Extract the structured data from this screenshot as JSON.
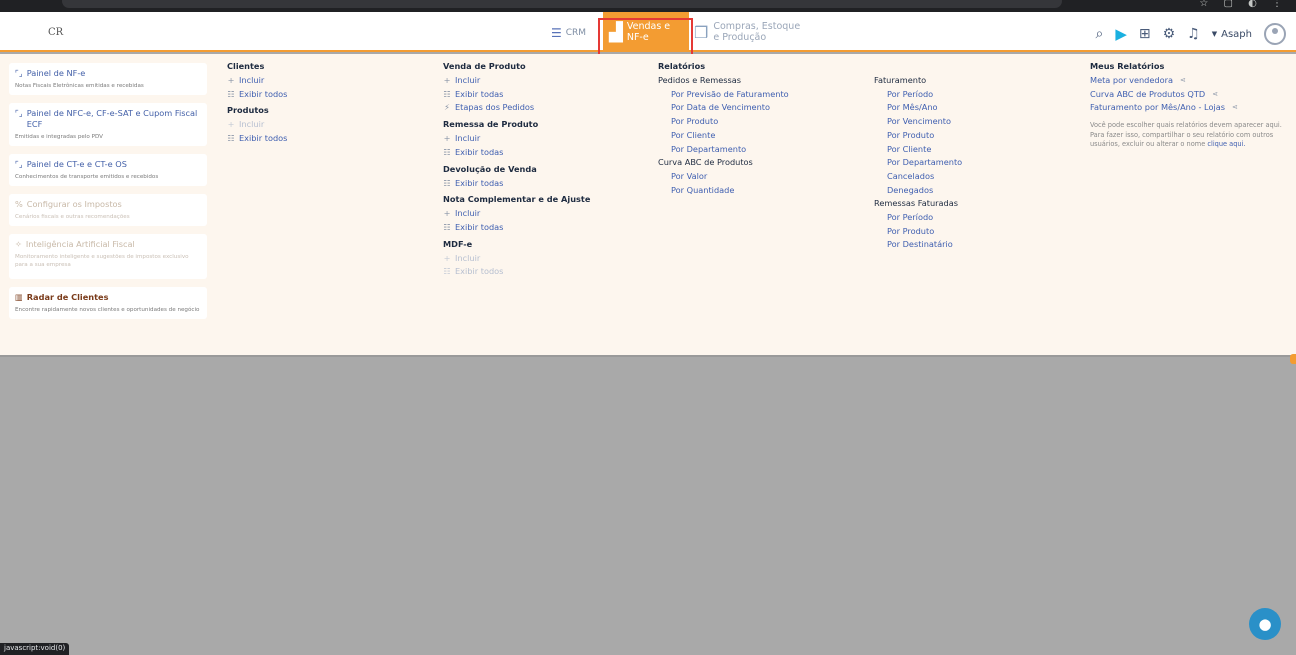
{
  "header": {
    "logo": "CR",
    "nav": {
      "crm": "CRM",
      "vendas": "Vendas e\nNF-e",
      "compras": "Compras, Estoque\ne Produção"
    },
    "user": "Asaph"
  },
  "cards": [
    {
      "title": "Painel de NF-e",
      "desc": "Notas Fiscais Eletrônicas emitidas e recebidas"
    },
    {
      "title": "Painel de NFC-e, CF-e-SAT e Cupom Fiscal ECF",
      "desc": "Emitidas e integradas pelo PDV"
    },
    {
      "title": "Painel de CT-e e CT-e OS",
      "desc": "Conhecimentos de transporte emitidos e recebidos"
    },
    {
      "title": "Configurar os Impostos",
      "desc": "Cenários fiscais e outras recomendações"
    },
    {
      "title": "Inteligência Artificial Fiscal",
      "desc": "Monitoramento inteligente e sugestões de impostos exclusivo para a sua empresa"
    },
    {
      "title": "Radar de Clientes",
      "desc": "Encontre rapidamente novos clientes e oportunidades de negócio"
    }
  ],
  "clientes": {
    "heading": "Clientes",
    "incluir": "Incluir",
    "exibir": "Exibir todos"
  },
  "produtos": {
    "heading": "Produtos",
    "incluir": "Incluir",
    "exibir": "Exibir todos"
  },
  "venda": {
    "heading": "Venda de Produto",
    "incluir": "Incluir",
    "exibir": "Exibir todas",
    "etapas": "Etapas dos Pedidos"
  },
  "remessa": {
    "heading": "Remessa de Produto",
    "incluir": "Incluir",
    "exibir": "Exibir todas"
  },
  "devolucao": {
    "heading": "Devolução de Venda",
    "exibir": "Exibir todas"
  },
  "nota": {
    "heading": "Nota Complementar e de Ajuste",
    "incluir": "Incluir",
    "exibir": "Exibir todas"
  },
  "mdfe": {
    "heading": "MDF-e",
    "incluir": "Incluir",
    "exibir": "Exibir todos"
  },
  "relatorios": {
    "heading": "Relatórios",
    "pedidos": "Pedidos e Remessas",
    "pedidos_items": [
      "Por Previsão de Faturamento",
      "Por Data de Vencimento",
      "Por Produto",
      "Por Cliente",
      "Por Departamento"
    ],
    "curva": "Curva ABC de Produtos",
    "curva_items": [
      "Por Valor",
      "Por Quantidade"
    ],
    "faturamento": "Faturamento",
    "faturamento_items": [
      "Por Período",
      "Por Mês/Ano",
      "Por Vencimento",
      "Por Produto",
      "Por Cliente",
      "Por Departamento",
      "Cancelados",
      "Denegados"
    ],
    "remessas": "Remessas Faturadas",
    "remessas_items": [
      "Por Período",
      "Por Produto",
      "Por Destinatário"
    ]
  },
  "meus": {
    "heading": "Meus Relatórios",
    "items": [
      "Meta por vendedora",
      "Curva ABC de Produtos QTD",
      "Faturamento por Mês/Ano - Lojas"
    ],
    "note1": "Você pode escolher quais relatórios devem aparecer aqui.",
    "note2": "Para fazer isso, compartilhar o seu relatório com outros usuários, excluir ou alterar o nome",
    "note_link": "clique aqui."
  },
  "status": "javascript:void(0)",
  "colors": {
    "accent": "#f39c32",
    "link": "#3f5fb0",
    "highlight": "#e53935"
  }
}
